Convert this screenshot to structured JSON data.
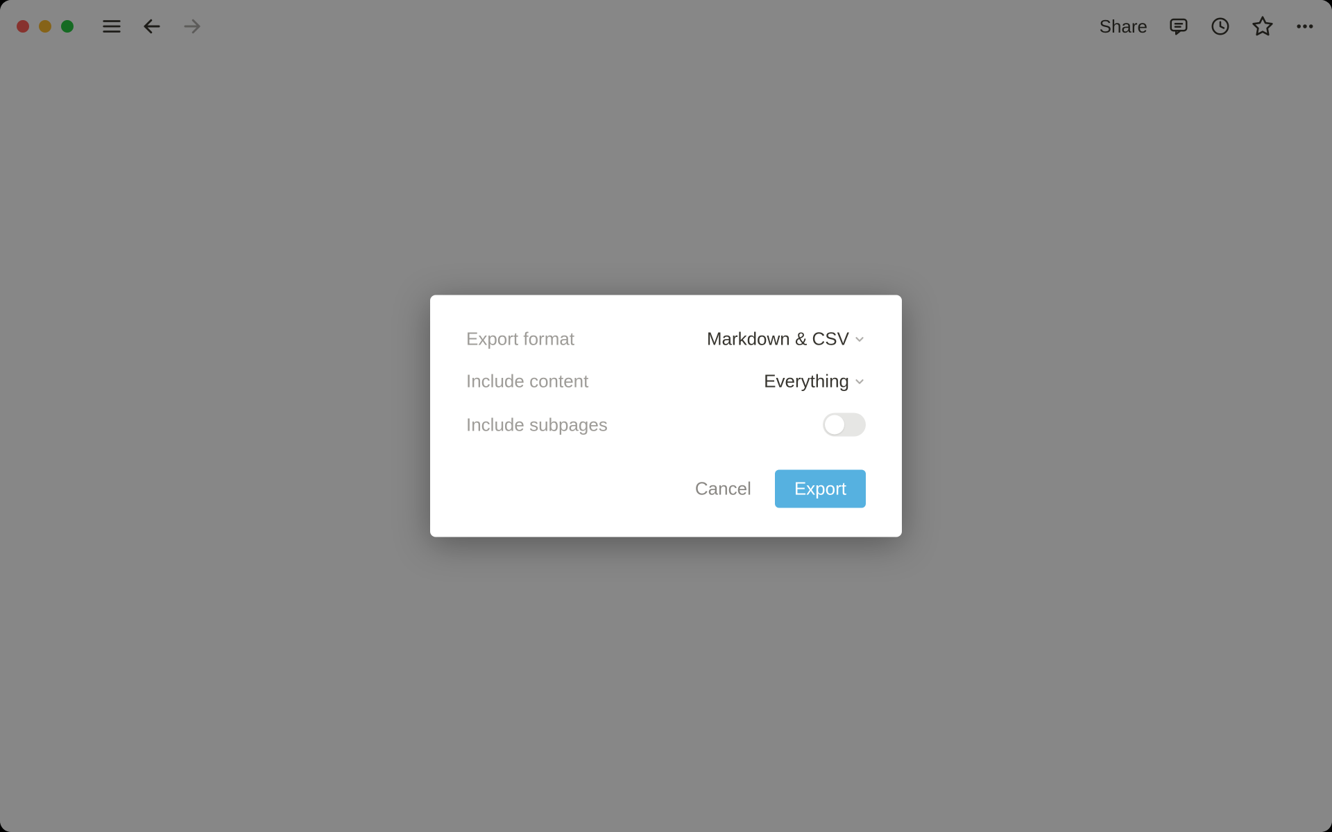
{
  "toolbar": {
    "share_label": "Share"
  },
  "modal": {
    "rows": [
      {
        "label": "Export format",
        "value": "Markdown & CSV"
      },
      {
        "label": "Include content",
        "value": "Everything"
      },
      {
        "label": "Include subpages",
        "toggle": false
      }
    ],
    "cancel_label": "Cancel",
    "export_label": "Export"
  }
}
